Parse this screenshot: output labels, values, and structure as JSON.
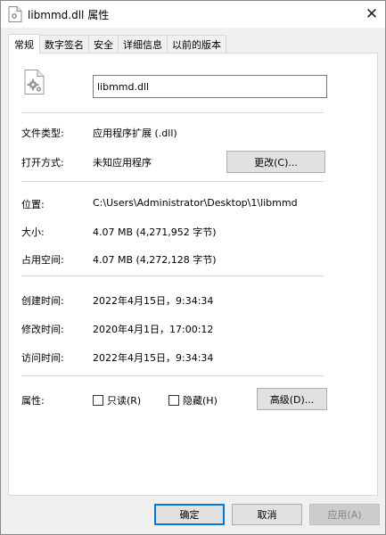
{
  "window": {
    "title": "libmmd.dll 属性",
    "close_glyph": "✕",
    "app_icon": "file-gear-icon"
  },
  "tabs": [
    {
      "label": "常规",
      "active": true
    },
    {
      "label": "数字签名",
      "active": false
    },
    {
      "label": "安全",
      "active": false
    },
    {
      "label": "详细信息",
      "active": false
    },
    {
      "label": "以前的版本",
      "active": false
    }
  ],
  "general": {
    "file_name": "libmmd.dll",
    "file_icon": "dll-gear-icon",
    "type_label": "文件类型:",
    "type_value": "应用程序扩展 (.dll)",
    "opens_with_label": "打开方式:",
    "opens_with_value": "未知应用程序",
    "change_button": "更改(C)...",
    "location_label": "位置:",
    "location_value": "C:\\Users\\Administrator\\Desktop\\1\\libmmd",
    "size_label": "大小:",
    "size_value": "4.07 MB (4,271,952 字节)",
    "size_on_disk_label": "占用空间:",
    "size_on_disk_value": "4.07 MB (4,272,128 字节)",
    "created_label": "创建时间:",
    "created_value": "2022年4月15日，9:34:34",
    "modified_label": "修改时间:",
    "modified_value": "2020年4月1日，17:00:12",
    "accessed_label": "访问时间:",
    "accessed_value": "2022年4月15日，9:34:34",
    "attributes_label": "属性:",
    "readonly_label": "只读(R)",
    "readonly_checked": false,
    "hidden_label": "隐藏(H)",
    "hidden_checked": false,
    "advanced_button": "高级(D)..."
  },
  "footer": {
    "ok": "确定",
    "cancel": "取消",
    "apply": "应用(A)",
    "apply_enabled": false
  },
  "colors": {
    "default_button_border": "#0078d7",
    "dialog_background": "#f0f0f0"
  }
}
